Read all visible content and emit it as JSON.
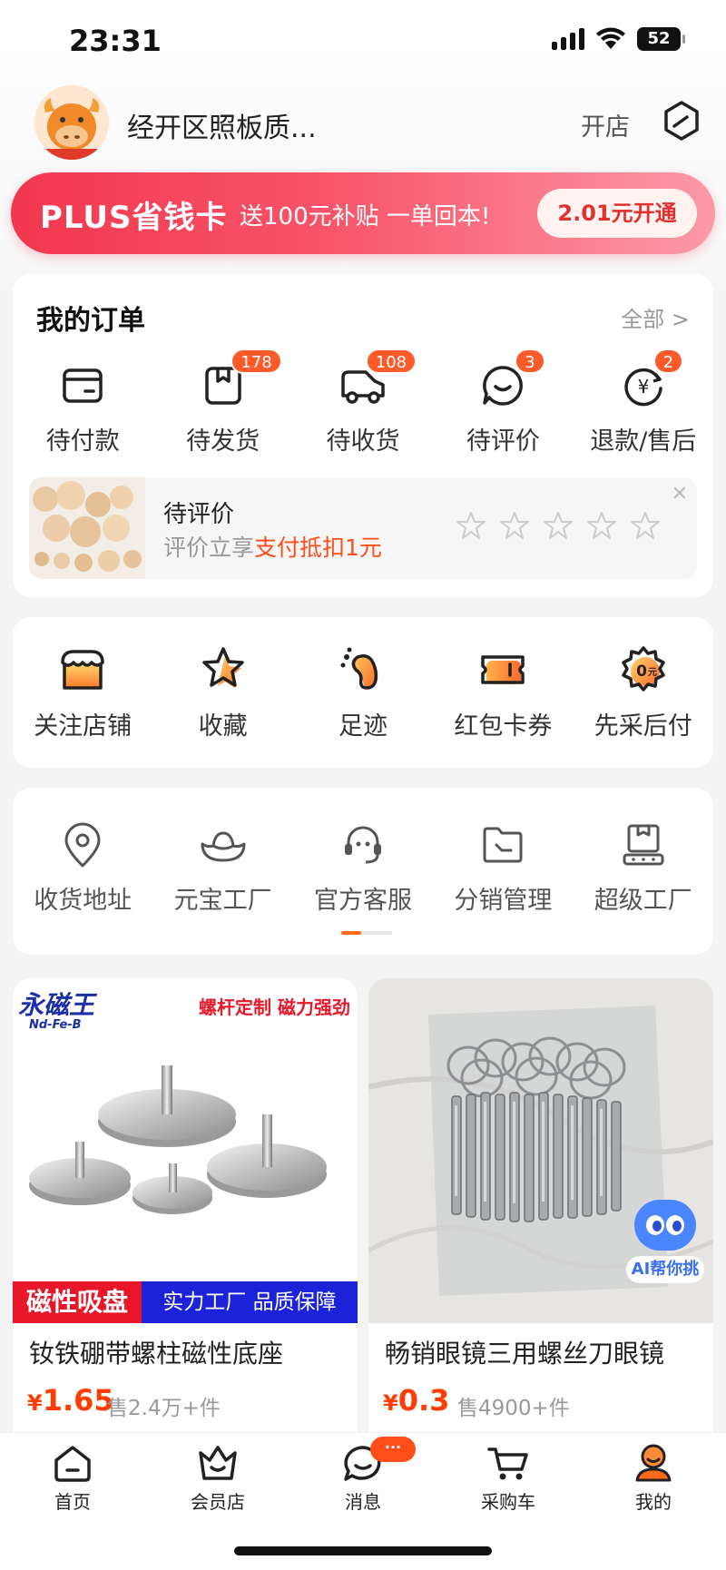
{
  "status_bar": {
    "time": "23:31",
    "battery": "52"
  },
  "header": {
    "shop_name": "经开区照板质...",
    "open_shop": "开店"
  },
  "plus_banner": {
    "title": "PLUS省钱卡",
    "subtitle": "送100元补贴 一单回本!",
    "button": "2.01元开通"
  },
  "orders": {
    "title": "我的订单",
    "more": "全部 >",
    "items": [
      {
        "label": "待付款",
        "icon": "wallet-icon",
        "badge": null
      },
      {
        "label": "待发货",
        "icon": "package-icon",
        "badge": "178"
      },
      {
        "label": "待收货",
        "icon": "truck-icon",
        "badge": "108"
      },
      {
        "label": "待评价",
        "icon": "comment-icon",
        "badge": "3"
      },
      {
        "label": "退款/售后",
        "icon": "refund-icon",
        "badge": "2"
      }
    ],
    "review_prompt": {
      "title": "待评价",
      "subtitle_prefix": "评价立享",
      "subtitle_highlight": "支付抵扣1元",
      "close": "✕"
    }
  },
  "tools": [
    {
      "label": "关注店铺",
      "icon": "shop-icon"
    },
    {
      "label": "收藏",
      "icon": "star-icon"
    },
    {
      "label": "足迹",
      "icon": "footprint-icon"
    },
    {
      "label": "红包卡券",
      "icon": "coupon-icon"
    },
    {
      "label": "先采后付",
      "icon": "pay-later-icon"
    }
  ],
  "services": [
    {
      "label": "收货地址",
      "icon": "location-icon"
    },
    {
      "label": "元宝工厂",
      "icon": "ingot-icon"
    },
    {
      "label": "官方客服",
      "icon": "customer-service-icon"
    },
    {
      "label": "分销管理",
      "icon": "folder-icon"
    },
    {
      "label": "超级工厂",
      "icon": "factory-icon"
    }
  ],
  "products": [
    {
      "title": "钕铁硼带螺柱磁性底座",
      "currency": "¥",
      "price": "1.65",
      "sold": "售2.4万+件",
      "image": {
        "brand": "永磁王",
        "brand_sub": "Nd-Fe-B",
        "promo": "螺杆定制 磁力强劲",
        "tag_red": "磁性吸盘",
        "tag_blue": "实力工厂 品质保障"
      }
    },
    {
      "title": "畅销眼镜三用螺丝刀眼镜",
      "currency": "¥",
      "price": "0.3",
      "sold": "售4900+件",
      "ai_button": "AI帮你挑"
    }
  ],
  "tab_bar": {
    "message_badge": "···",
    "tabs": [
      {
        "label": "首页",
        "icon": "home-icon"
      },
      {
        "label": "会员店",
        "icon": "member-store-icon"
      },
      {
        "label": "消息",
        "icon": "message-icon"
      },
      {
        "label": "采购车",
        "icon": "cart-icon"
      },
      {
        "label": "我的",
        "icon": "profile-icon"
      }
    ]
  },
  "colors": {
    "accent": "#ff5a2a",
    "plus_red": "#f2374e",
    "price": "#ff3d00"
  }
}
